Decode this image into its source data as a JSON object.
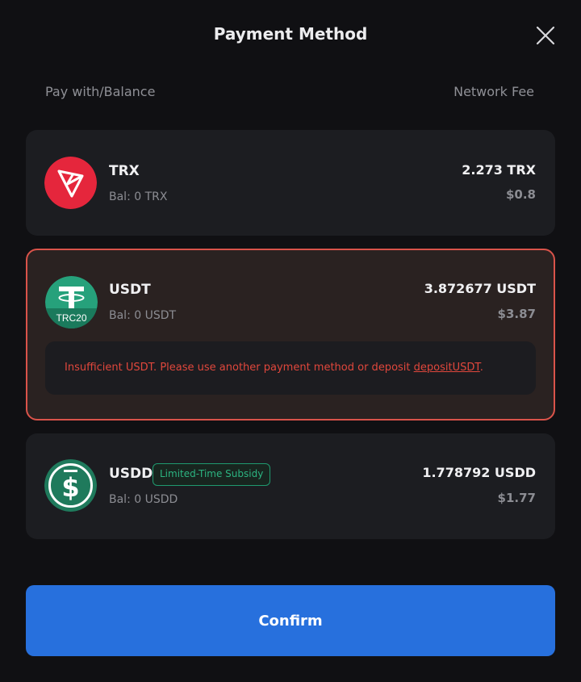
{
  "header": {
    "title": "Payment Method",
    "close_icon": "close-icon"
  },
  "columns": {
    "left": "Pay with/Balance",
    "right": "Network Fee"
  },
  "methods": [
    {
      "id": "trx",
      "icon": "tron-icon",
      "name": "TRX",
      "balance": "Bal: 0 TRX",
      "fee": "2.273 TRX",
      "fee_usd": "$0.8",
      "icon_color": "#e5263c"
    },
    {
      "id": "usdt",
      "icon": "tether-trc20-icon",
      "name": "USDT",
      "icon_label": "TRC20",
      "balance": "Bal: 0 USDT",
      "fee": "3.872677 USDT",
      "fee_usd": "$3.87",
      "icon_color": "#26a17b",
      "warning": {
        "text": "Insufficient USDT. Please use another payment method or deposit ",
        "link": "depositUSDT",
        "suffix": "."
      }
    },
    {
      "id": "usdd",
      "icon": "usdd-icon",
      "name": "USDD",
      "badge": "Limited-Time Subsidy",
      "balance": "Bal: 0 USDD",
      "fee": "1.778792 USDD",
      "fee_usd": "$1.77",
      "icon_color": "#1f7a5c"
    }
  ],
  "footer": {
    "confirm_label": "Confirm"
  },
  "colors": {
    "accent": "#2770dd",
    "error": "#e0473c",
    "selected_border": "#d9534a",
    "badge_green": "#2cb481"
  }
}
